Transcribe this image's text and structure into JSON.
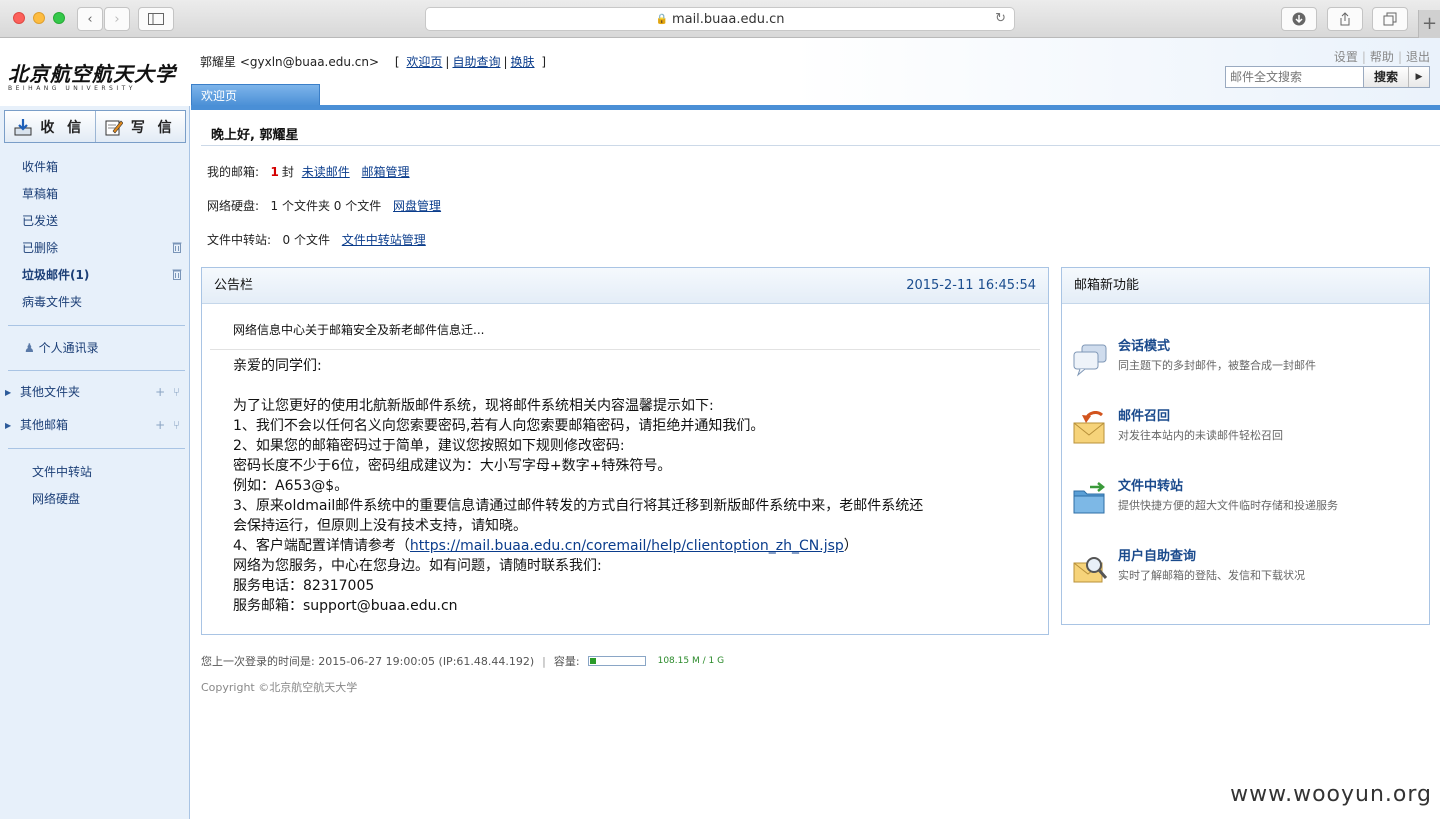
{
  "browser": {
    "url": "mail.buaa.edu.cn"
  },
  "header": {
    "logo_cn": "北京航空航天大学",
    "logo_en": "BEIHANG UNIVERSITY",
    "user_display": "郭耀星 <gyxln@buaa.edu.cn>",
    "bracket_open": "[",
    "bracket_close": "]",
    "links": [
      "欢迎页",
      "自助查询",
      "换肤"
    ],
    "top_links": [
      "设置",
      "帮助",
      "退出"
    ],
    "search_placeholder": "邮件全文搜索",
    "search_button": "搜索",
    "active_tab": "欢迎页"
  },
  "sidebar": {
    "receive_label": "收 信",
    "compose_label": "写 信",
    "folders": [
      "收件箱",
      "草稿箱",
      "已发送",
      "已删除",
      "垃圾邮件(1)",
      "病毒文件夹"
    ],
    "contacts": "个人通讯录",
    "other_folders": "其他文件夹",
    "other_mailboxes": "其他邮箱",
    "extra": [
      "文件中转站",
      "网络硬盘"
    ]
  },
  "main": {
    "greeting": "晚上好, 郭耀星",
    "mailbox": {
      "label": "我的邮箱:",
      "count": "1",
      "unit": "封",
      "unread_link": "未读邮件",
      "manage_link": "邮箱管理"
    },
    "netdisk": {
      "label": "网络硬盘:",
      "text": "1 个文件夹 0 个文件",
      "manage_link": "网盘管理"
    },
    "transfer": {
      "label": "文件中转站:",
      "text": "0 个文件",
      "manage_link": "文件中转站管理"
    }
  },
  "notice": {
    "title": "公告栏",
    "timestamp": "2015-2-11 16:45:54",
    "subject": "网络信息中心关于邮箱安全及新老邮件信息迁...",
    "lines": [
      "亲爱的同学们:",
      "",
      " 为了让您更好的使用北航新版邮件系统，现将邮件系统相关内容温馨提示如下:",
      "1、我们不会以任何名义向您索要密码,若有人向您索要邮箱密码，请拒绝并通知我们。",
      "2、如果您的邮箱密码过于简单，建议您按照如下规则修改密码:",
      "  密码长度不少于6位，密码组成建议为：大小写字母+数字+特殊符号。",
      "   例如：A653@$。",
      "3、原来oldmail邮件系统中的重要信息请通过邮件转发的方式自行将其迁移到新版邮件系统中来，老邮件系统还",
      "会保持运行，但原则上没有技术支持，请知晓。"
    ],
    "ref_prefix": "4、客户端配置详情请参考（",
    "ref_link": "https://mail.buaa.edu.cn/coremail/help/clientoption_zh_CN.jsp",
    "ref_suffix": "）",
    "tail": [
      "网络为您服务，中心在您身边。如有问题，请随时联系我们:",
      "服务电话：82317005",
      "服务邮箱：support@buaa.edu.cn"
    ]
  },
  "features": {
    "title": "邮箱新功能",
    "items": [
      {
        "title": "会话模式",
        "desc": "同主题下的多封邮件，被整合成一封邮件",
        "icon": "chat-bubbles-icon"
      },
      {
        "title": "邮件召回",
        "desc": "对发往本站内的未读邮件轻松召回",
        "icon": "envelope-recall-icon"
      },
      {
        "title": "文件中转站",
        "desc": "提供快捷方便的超大文件临时存储和投递服务",
        "icon": "folder-transfer-icon"
      },
      {
        "title": "用户自助查询",
        "desc": "实时了解邮箱的登陆、发信和下载状况",
        "icon": "envelope-search-icon"
      }
    ]
  },
  "footer": {
    "last_login": "您上一次登录的时间是: 2015-06-27 19:00:05 (IP:61.48.44.192)",
    "sep": "|",
    "capacity_label": "容量:",
    "capacity_fraction": 0.106,
    "capacity_text": "108.15 M / 1 G",
    "copyright": "Copyright ©北京航空航天大学"
  },
  "watermark": "www.wooyun.org"
}
